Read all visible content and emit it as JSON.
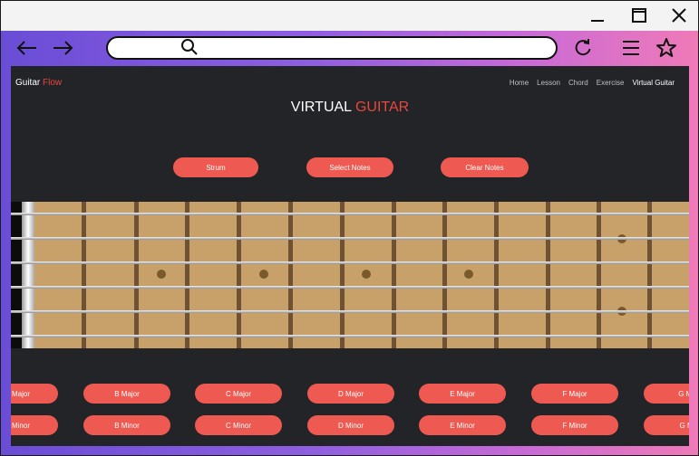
{
  "window": {
    "controls": [
      {
        "name": "minimize-icon",
        "glyph": "—"
      },
      {
        "name": "maximize-icon",
        "glyph": "☐"
      },
      {
        "name": "close-icon",
        "glyph": "✕"
      }
    ]
  },
  "browser": {
    "icons": {
      "back": "back-arrow-icon",
      "forward": "forward-arrow-icon",
      "search": "search-icon",
      "reload": "reload-icon",
      "menu": "menu-icon",
      "favorite": "star-icon"
    }
  },
  "site": {
    "brand": {
      "part1": "Guitar",
      "part2": "Flow"
    },
    "nav": [
      "Home",
      "Lesson",
      "Chord",
      "Exercise",
      "Virtual Guitar"
    ],
    "active_nav": "Virtual Guitar",
    "title": {
      "part1": "VIRTUAL",
      "part2": "GUITAR"
    }
  },
  "controls": {
    "strum": "Strum",
    "select_notes": "Select Notes",
    "clear_notes": "Clear Notes"
  },
  "chords": {
    "major": [
      "Major",
      "B Major",
      "C Major",
      "D Major",
      "E Major",
      "F Major",
      "G Ma"
    ],
    "minor": [
      "Minor",
      "B Minor",
      "C Minor",
      "D Minor",
      "E Minor",
      "F Minor",
      "G Mi"
    ]
  },
  "colors": {
    "accent": "#e8473f",
    "button": "#ee5a52",
    "page_bg": "#222428",
    "fretboard": "#c8a06a"
  }
}
